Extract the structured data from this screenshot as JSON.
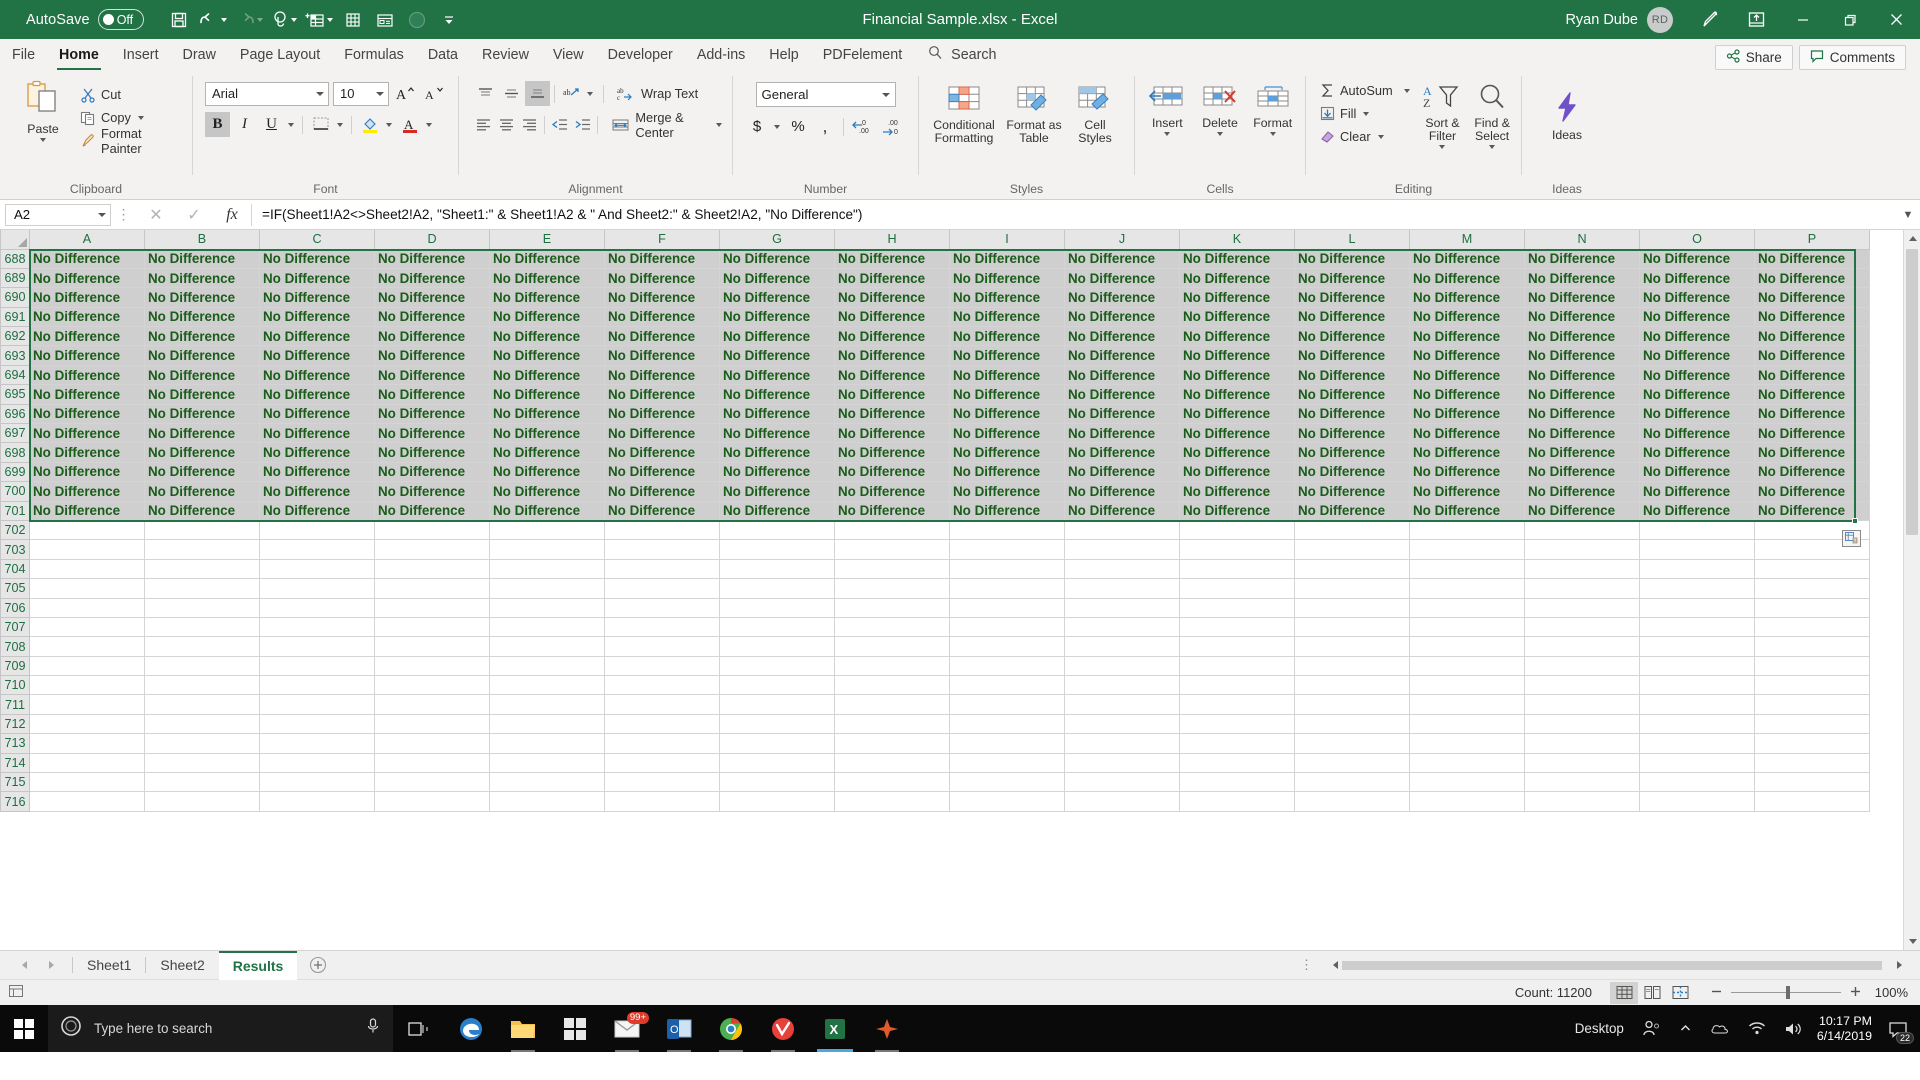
{
  "titlebar": {
    "autosave_label": "AutoSave",
    "autosave_state": "Off",
    "document_title": "Financial Sample.xlsx  -  Excel",
    "user_name": "Ryan Dube",
    "user_initials": "RD",
    "qat_items": [
      "save-icon",
      "undo-icon",
      "redo-icon",
      "touch-mode-icon",
      "new-sheet-icon",
      "sort-icon",
      "form-icon",
      "record-macro-icon",
      "customize-qat-icon"
    ],
    "window_buttons": [
      "minimize",
      "restore",
      "close"
    ],
    "ribbon_display_icon": "ribbon-display-options-icon",
    "pen_icon": "pen-icon"
  },
  "tabs": {
    "items": [
      "File",
      "Home",
      "Insert",
      "Draw",
      "Page Layout",
      "Formulas",
      "Data",
      "Review",
      "View",
      "Developer",
      "Add-ins",
      "Help",
      "PDFelement"
    ],
    "active": "Home",
    "search_placeholder": "Search",
    "share_label": "Share",
    "comments_label": "Comments"
  },
  "ribbon": {
    "groups": [
      "Clipboard",
      "Font",
      "Alignment",
      "Number",
      "Styles",
      "Cells",
      "Editing",
      "Ideas"
    ],
    "clipboard": {
      "paste": "Paste",
      "cut": "Cut",
      "copy": "Copy",
      "format_painter": "Format Painter"
    },
    "font": {
      "family": "Arial",
      "size": "10",
      "bold": "B",
      "italic": "I",
      "underline": "U",
      "bold_active": true
    },
    "alignment": {
      "wrap_text": "Wrap Text",
      "merge_center": "Merge & Center",
      "bottom_align_active": true
    },
    "number": {
      "format": "General",
      "currency": "$",
      "percent": "%",
      "comma": ","
    },
    "styles": {
      "conditional_formatting_l1": "Conditional",
      "conditional_formatting_l2": "Formatting",
      "format_as_table_l1": "Format as",
      "format_as_table_l2": "Table",
      "cell_styles_l1": "Cell",
      "cell_styles_l2": "Styles"
    },
    "cells": {
      "insert": "Insert",
      "delete": "Delete",
      "format": "Format"
    },
    "editing": {
      "autosum": "AutoSum",
      "fill": "Fill",
      "clear": "Clear",
      "sort_filter_l1": "Sort &",
      "sort_filter_l2": "Filter",
      "find_select_l1": "Find &",
      "find_select_l2": "Select"
    },
    "ideas": {
      "label": "Ideas"
    }
  },
  "formula_bar": {
    "name_box": "A2",
    "formula": "=IF(Sheet1!A2<>Sheet2!A2, \"Sheet1:\" & Sheet1!A2 & \" And Sheet2:\" & Sheet2!A2, \"No Difference\")",
    "cancel_icon": "x-icon",
    "enter_icon": "check-icon",
    "fx_icon": "fx-icon",
    "expand_icon": "chevron-down-icon"
  },
  "grid": {
    "columns": [
      "A",
      "B",
      "C",
      "D",
      "E",
      "F",
      "G",
      "H",
      "I",
      "J",
      "K",
      "L",
      "M",
      "N",
      "O",
      "P"
    ],
    "first_row": 688,
    "last_filled_row": 701,
    "last_row": 716,
    "cell_text": "No Difference",
    "selected_cell": "A2"
  },
  "sheet_tabs": {
    "items": [
      "Sheet1",
      "Sheet2",
      "Results"
    ],
    "active": "Results",
    "add_label": "+"
  },
  "status_bar": {
    "count_label": "Count: 11200",
    "zoom": "100%",
    "views": [
      "normal-view-icon",
      "page-layout-icon",
      "page-break-preview-icon"
    ],
    "active_view": "normal-view-icon"
  },
  "taskbar": {
    "search_placeholder": "Type here to search",
    "apps": [
      "task-view-icon",
      "edge-icon",
      "file-explorer-icon",
      "store-icon",
      "mail-icon",
      "outlook-icon",
      "chrome-icon",
      "vivaldi-icon",
      "excel-icon",
      "app-icon"
    ],
    "mail_badge": "99+",
    "desktop_label": "Desktop",
    "time": "10:17 PM",
    "date": "6/14/2019",
    "notification_count": "22",
    "overflow_icon": "chevron-up-icon"
  },
  "colors": {
    "excel_green": "#217346",
    "cell_text_green": "#1a5c1a",
    "selection_green": "#217346",
    "cell_fill_gray": "#cfcfcf",
    "ribbon_bg": "#f3f2f1"
  }
}
